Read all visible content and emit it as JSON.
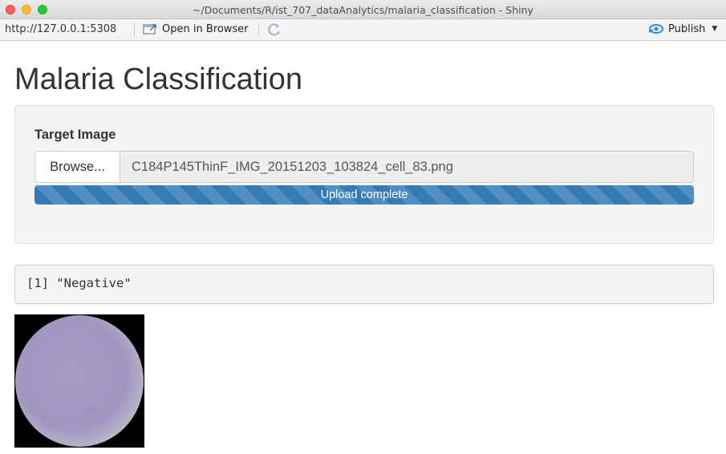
{
  "window": {
    "title": "~/Documents/R/ist_707_dataAnalytics/malaria_classification - Shiny"
  },
  "toolbar": {
    "url": "http://127.0.0.1:5308",
    "open_in_browser_label": "Open in Browser",
    "publish_label": "Publish",
    "icons": {
      "open_in_browser": "open-in-browser-icon",
      "refresh": "refresh-icon",
      "publish": "publish-icon",
      "dropdown": "chevron-down-icon"
    }
  },
  "app": {
    "title": "Malaria Classification",
    "file_input": {
      "label": "Target Image",
      "browse_label": "Browse...",
      "filename": "C184P145ThinF_IMG_20151203_103824_cell_83.png",
      "progress_text": "Upload complete",
      "progress_fraction": 1.0
    },
    "output_text": "[1] \"Negative\""
  },
  "colors": {
    "progress_bar": "#337ab7",
    "well_background": "#f5f5f5",
    "cell_color": "#a69cc4"
  }
}
